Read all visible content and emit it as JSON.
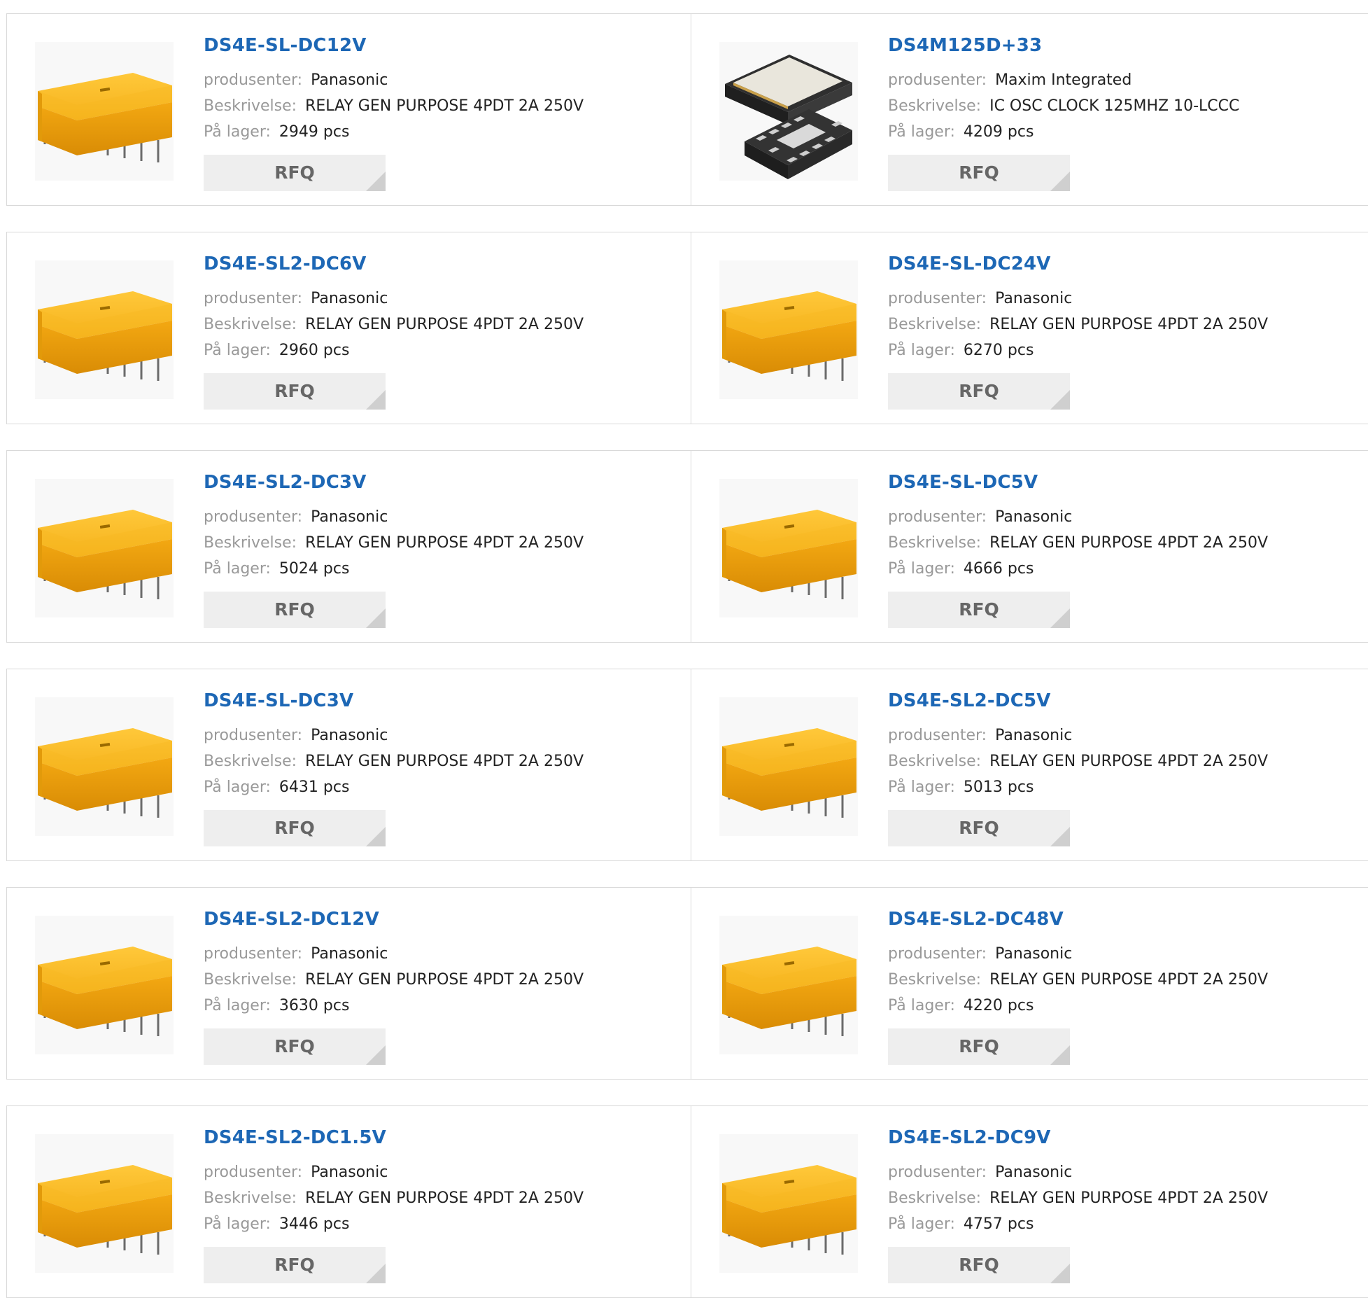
{
  "labels": {
    "manufacturer": "produsenter:",
    "description": "Beskrivelse:",
    "stock": "På lager:",
    "rfq": "RFQ"
  },
  "products": [
    {
      "part": "DS4E-SL-DC12V",
      "manufacturer": "Panasonic",
      "description": "RELAY GEN PURPOSE 4PDT 2A 250V",
      "stock": "2949 pcs",
      "image": "relay-image"
    },
    {
      "part": "DS4M125D+33",
      "manufacturer": "Maxim Integrated",
      "description": "IC OSC CLOCK 125MHZ 10-LCCC",
      "stock": "4209 pcs",
      "image": "ic-chip-image"
    },
    {
      "part": "DS4E-SL2-DC6V",
      "manufacturer": "Panasonic",
      "description": "RELAY GEN PURPOSE 4PDT 2A 250V",
      "stock": "2960 pcs",
      "image": "relay-image"
    },
    {
      "part": "DS4E-SL-DC24V",
      "manufacturer": "Panasonic",
      "description": "RELAY GEN PURPOSE 4PDT 2A 250V",
      "stock": "6270 pcs",
      "image": "relay-image"
    },
    {
      "part": "DS4E-SL2-DC3V",
      "manufacturer": "Panasonic",
      "description": "RELAY GEN PURPOSE 4PDT 2A 250V",
      "stock": "5024 pcs",
      "image": "relay-image"
    },
    {
      "part": "DS4E-SL-DC5V",
      "manufacturer": "Panasonic",
      "description": "RELAY GEN PURPOSE 4PDT 2A 250V",
      "stock": "4666 pcs",
      "image": "relay-image"
    },
    {
      "part": "DS4E-SL-DC3V",
      "manufacturer": "Panasonic",
      "description": "RELAY GEN PURPOSE 4PDT 2A 250V",
      "stock": "6431 pcs",
      "image": "relay-image"
    },
    {
      "part": "DS4E-SL2-DC5V",
      "manufacturer": "Panasonic",
      "description": "RELAY GEN PURPOSE 4PDT 2A 250V",
      "stock": "5013 pcs",
      "image": "relay-image"
    },
    {
      "part": "DS4E-SL2-DC12V",
      "manufacturer": "Panasonic",
      "description": "RELAY GEN PURPOSE 4PDT 2A 250V",
      "stock": "3630 pcs",
      "image": "relay-image"
    },
    {
      "part": "DS4E-SL2-DC48V",
      "manufacturer": "Panasonic",
      "description": "RELAY GEN PURPOSE 4PDT 2A 250V",
      "stock": "4220 pcs",
      "image": "relay-image"
    },
    {
      "part": "DS4E-SL2-DC1.5V",
      "manufacturer": "Panasonic",
      "description": "RELAY GEN PURPOSE 4PDT 2A 250V",
      "stock": "3446 pcs",
      "image": "relay-image"
    },
    {
      "part": "DS4E-SL2-DC9V",
      "manufacturer": "Panasonic",
      "description": "RELAY GEN PURPOSE 4PDT 2A 250V",
      "stock": "4757 pcs",
      "image": "relay-image"
    }
  ],
  "colors": {
    "link": "#1d67b5",
    "label": "#999999",
    "value": "#222222",
    "button_bg": "#eeeeee",
    "button_text": "#666666",
    "relay_body": "#f0ab12",
    "border": "#d9d9d9"
  }
}
